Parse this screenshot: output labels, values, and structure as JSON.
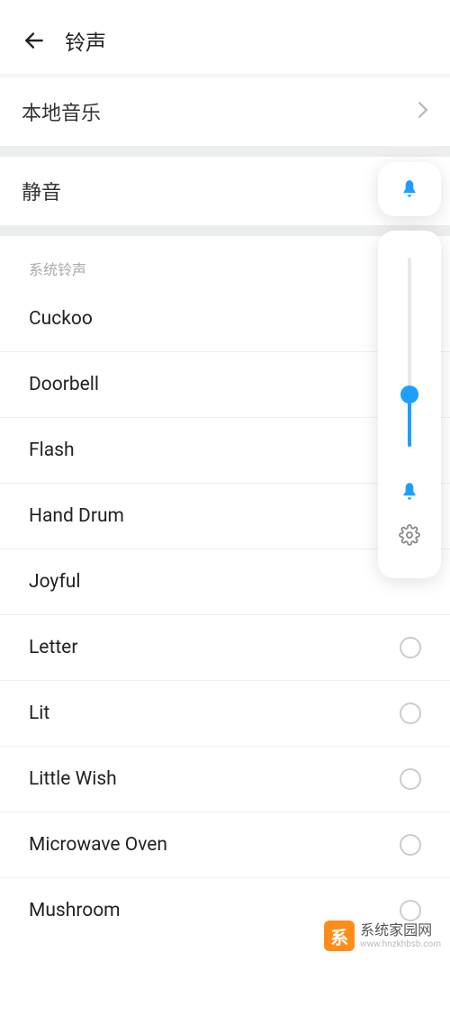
{
  "header": {
    "title": "铃声"
  },
  "local_music": {
    "label": "本地音乐"
  },
  "silent": {
    "label": "静音"
  },
  "system_section": {
    "header": "系统铃声"
  },
  "ringtones": [
    {
      "name": "Cuckoo",
      "has_radio": false
    },
    {
      "name": "Doorbell",
      "has_radio": false
    },
    {
      "name": "Flash",
      "has_radio": false
    },
    {
      "name": "Hand Drum",
      "has_radio": false
    },
    {
      "name": "Joyful",
      "has_radio": false
    },
    {
      "name": "Letter",
      "has_radio": true
    },
    {
      "name": "Lit",
      "has_radio": true
    },
    {
      "name": "Little Wish",
      "has_radio": true
    },
    {
      "name": "Microwave Oven",
      "has_radio": true
    },
    {
      "name": "Mushroom",
      "has_radio": true
    }
  ],
  "watermark": {
    "badge": "系",
    "main": "系统家园网",
    "sub": "www.hnzkhbsb.com"
  }
}
